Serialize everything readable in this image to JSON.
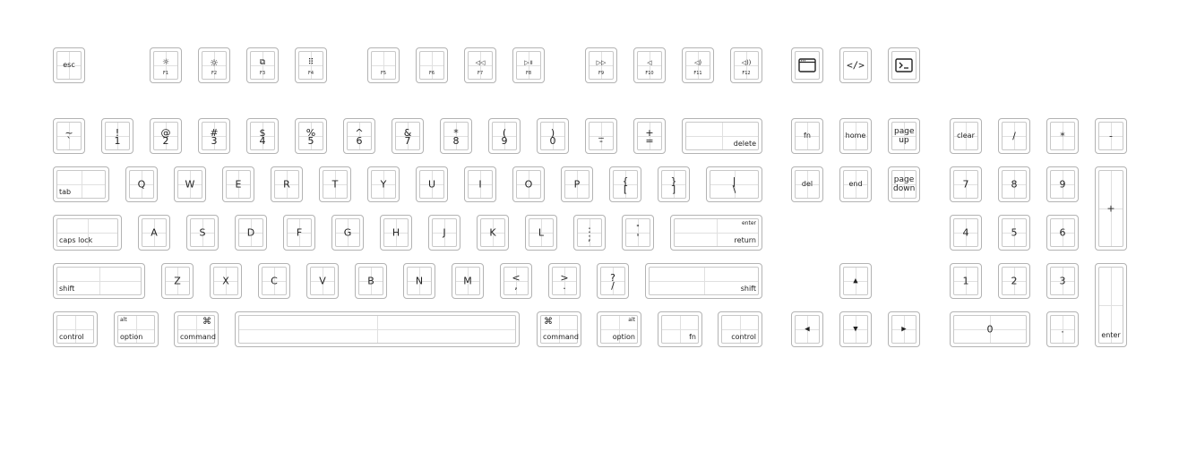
{
  "keyboard": {
    "fn_row": {
      "esc": "esc",
      "f1": "F1",
      "f1_icon": "☼",
      "f2": "F2",
      "f2_icon": "☼",
      "f3": "F3",
      "f3_icon": "⧉",
      "f4": "F4",
      "f4_icon": "⠿",
      "f5": "F5",
      "f6": "F6",
      "f7": "F7",
      "f7_icon": "◁◁",
      "f8": "F8",
      "f8_icon": "▷॥",
      "f9": "F9",
      "f9_icon": "▷▷",
      "f10": "F10",
      "f10_icon": "◁",
      "f11": "F11",
      "f11_icon": "◁)",
      "f12": "F12",
      "f12_icon": "◁))",
      "code_icon": "</>"
    },
    "number_row": {
      "backtick": [
        "~",
        "`"
      ],
      "k1": [
        "!",
        "1"
      ],
      "k2": [
        "@",
        "2"
      ],
      "k3": [
        "#",
        "3"
      ],
      "k4": [
        "$",
        "4"
      ],
      "k5": [
        "%",
        "5"
      ],
      "k6": [
        "^",
        "6"
      ],
      "k7": [
        "&",
        "7"
      ],
      "k8": [
        "*",
        "8"
      ],
      "k9": [
        "(",
        "9"
      ],
      "k0": [
        ")",
        "0"
      ],
      "minus": [
        "_",
        "-"
      ],
      "equal": [
        "+",
        "="
      ],
      "delete": "delete"
    },
    "qwerty_row": {
      "tab": "tab",
      "letters": [
        "Q",
        "W",
        "E",
        "R",
        "T",
        "Y",
        "U",
        "I",
        "O",
        "P"
      ],
      "lbracket": [
        "{",
        "["
      ],
      "rbracket": [
        "}",
        "]"
      ],
      "backslash": [
        "|",
        "\\"
      ]
    },
    "home_row": {
      "caps": "caps lock",
      "letters": [
        "A",
        "S",
        "D",
        "F",
        "G",
        "H",
        "J",
        "K",
        "L"
      ],
      "semicolon": [
        ":",
        ";"
      ],
      "quote": [
        "\"",
        "'"
      ],
      "enter_top": "enter",
      "return": "return"
    },
    "shift_row": {
      "shift_left": "shift",
      "letters": [
        "Z",
        "X",
        "C",
        "V",
        "B",
        "N",
        "M"
      ],
      "comma": [
        "<",
        ","
      ],
      "period": [
        ">",
        "."
      ],
      "slash": [
        "?",
        "/"
      ],
      "shift_right": "shift"
    },
    "bottom_row": {
      "control_left": "control",
      "option_left": "option",
      "alt_left": "alt",
      "command_left": "command",
      "cmd_symbol_left": "⌘",
      "command_right": "command",
      "cmd_symbol_right": "⌘",
      "option_right": "option",
      "alt_right": "alt",
      "fn": "fn",
      "control_right": "control"
    },
    "nav_cluster": {
      "fn": "fn",
      "home": "home",
      "page_up": "page up",
      "del": "del",
      "end": "end",
      "page_down": "page down",
      "arrow_up": "▲",
      "arrow_left": "◀",
      "arrow_down": "▼",
      "arrow_right": "▶"
    },
    "numpad": {
      "clear": "clear",
      "divide": "/",
      "multiply": "*",
      "minus": "-",
      "n7": "7",
      "n8": "8",
      "n9": "9",
      "plus": "+",
      "n4": "4",
      "n5": "5",
      "n6": "6",
      "n1": "1",
      "n2": "2",
      "n3": "3",
      "n0": "0",
      "decimal": ".",
      "enter": "enter"
    },
    "colors": {
      "border": "#b3b3b3",
      "inner": "#c8c8c8",
      "grid": "#e0e0e0",
      "text": "#222222"
    }
  }
}
